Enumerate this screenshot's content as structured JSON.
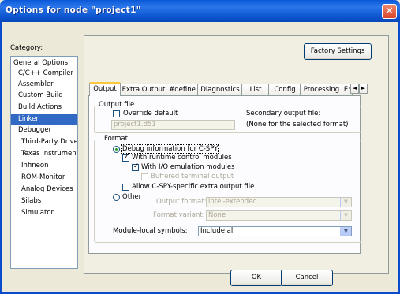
{
  "window": {
    "title": "Options for node \"project1\"",
    "close_glyph": "✕"
  },
  "category": {
    "label": "Category:",
    "items": [
      {
        "label": "General Options"
      },
      {
        "label": "C/C++ Compiler"
      },
      {
        "label": "Assembler"
      },
      {
        "label": "Custom Build"
      },
      {
        "label": "Build Actions"
      },
      {
        "label": "Linker",
        "selected": true
      },
      {
        "label": "Debugger"
      },
      {
        "label": "Third-Party Driver"
      },
      {
        "label": "Texas Instruments"
      },
      {
        "label": "Infineon"
      },
      {
        "label": "ROM-Monitor"
      },
      {
        "label": "Analog Devices"
      },
      {
        "label": "Silabs"
      },
      {
        "label": "Simulator"
      }
    ]
  },
  "factory_settings_label": "Factory Settings",
  "tabs": [
    "Output",
    "Extra Output",
    "#define",
    "Diagnostics",
    "List",
    "Config",
    "Processing",
    "E:"
  ],
  "tab_scroll": {
    "left": "◄",
    "right": "►"
  },
  "output_file": {
    "group_title": "Output file",
    "override_label": "Override default",
    "override_checked": false,
    "filename": "project1.d51",
    "secondary_label": "Secondary output file:",
    "secondary_value": "(None for the selected format)"
  },
  "format": {
    "group_title": "Format",
    "debug_info_label": "Debug information for C-SPY",
    "runtime_label": "With runtime control modules",
    "io_label": "With I/O emulation modules",
    "buffered_label": "Buffered terminal output",
    "allow_label": "Allow C-SPY-specific extra output file",
    "other_label": "Other",
    "output_format_label": "Output format:",
    "output_format_value": "intel-extended",
    "format_variant_label": "Format variant:",
    "format_variant_value": "None",
    "module_local_label": "Module-local symbols:",
    "module_local_value": "Include all"
  },
  "buttons": {
    "ok": "OK",
    "cancel": "Cancel"
  },
  "check_glyph": "✓"
}
